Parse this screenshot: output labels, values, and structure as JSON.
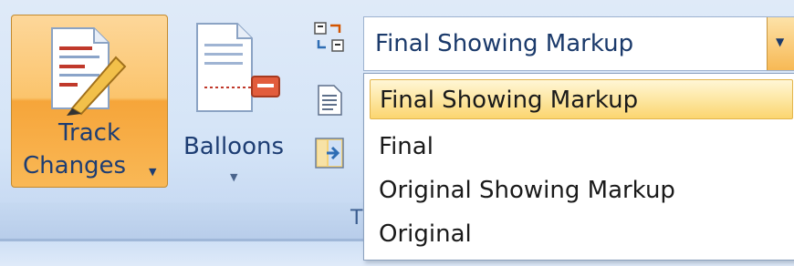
{
  "ribbon": {
    "track_changes": {
      "label_line1": "Track",
      "label_line2": "Changes",
      "icon": "track-changes-icon"
    },
    "balloons": {
      "label": "Balloons",
      "icon": "balloons-icon"
    },
    "small_buttons": [
      {
        "icon": "display-for-review-icon"
      },
      {
        "icon": "show-markup-icon"
      },
      {
        "icon": "reviewing-pane-icon"
      }
    ],
    "group_label": "T"
  },
  "display_for_review": {
    "selected_value": "Final Showing Markup",
    "options": [
      {
        "label": "Final Showing Markup",
        "selected": true
      },
      {
        "label": "Final",
        "selected": false
      },
      {
        "label": "Original Showing Markup",
        "selected": false
      },
      {
        "label": "Original",
        "selected": false
      }
    ]
  },
  "colors": {
    "accent": "#f7b955",
    "ribbon_bg": "#d4e4f7",
    "text": "#1d3d73"
  }
}
